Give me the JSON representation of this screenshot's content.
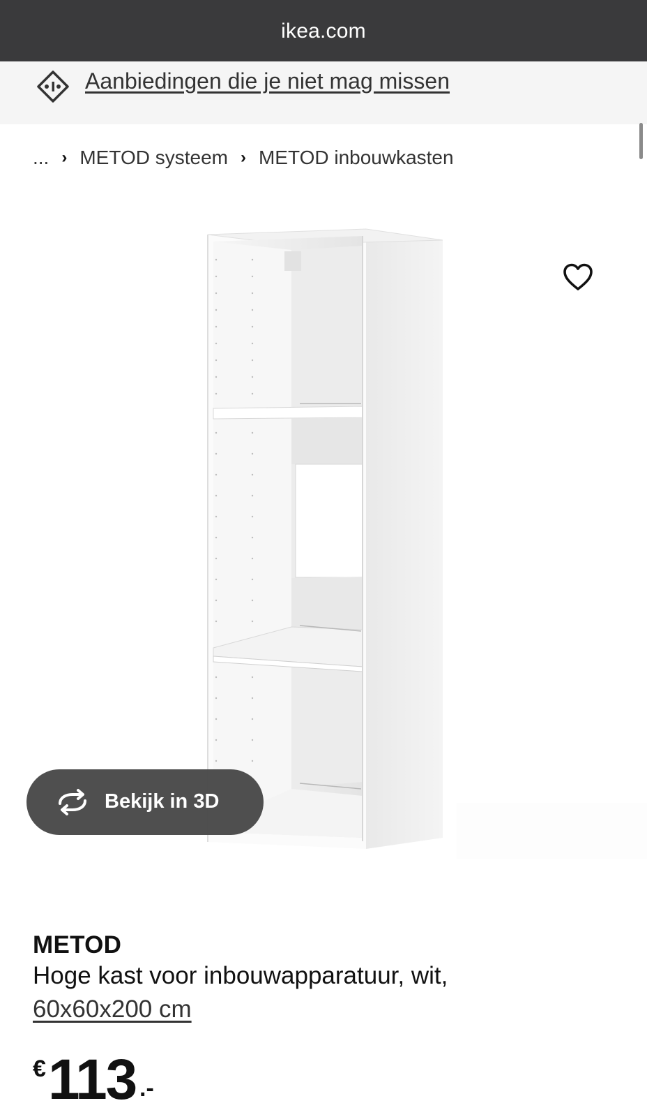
{
  "browser": {
    "url": "ikea.com"
  },
  "promo": {
    "link_text": "Aanbiedingen die je niet mag missen",
    "icon": "tag-icon"
  },
  "breadcrumb": {
    "ellipsis": "...",
    "items": [
      {
        "label": "METOD systeem"
      },
      {
        "label": "METOD inbouwkasten"
      }
    ],
    "separator": "›"
  },
  "product": {
    "image": "white-tall-cabinet-image",
    "favorite_icon": "heart-icon",
    "view3d": {
      "label": "Bekijk in 3D",
      "icon": "rotate-3d-icon"
    },
    "name": "METOD",
    "description": "Hoge kast voor inbouwapparatuur, wit,",
    "size": "60x60x200 cm",
    "price": {
      "currency": "€",
      "amount": "113",
      "suffix": ".-"
    }
  },
  "colors": {
    "topbar": "#3a3a3c",
    "promo_bg": "#f5f5f5",
    "button_3d": "#484848"
  }
}
